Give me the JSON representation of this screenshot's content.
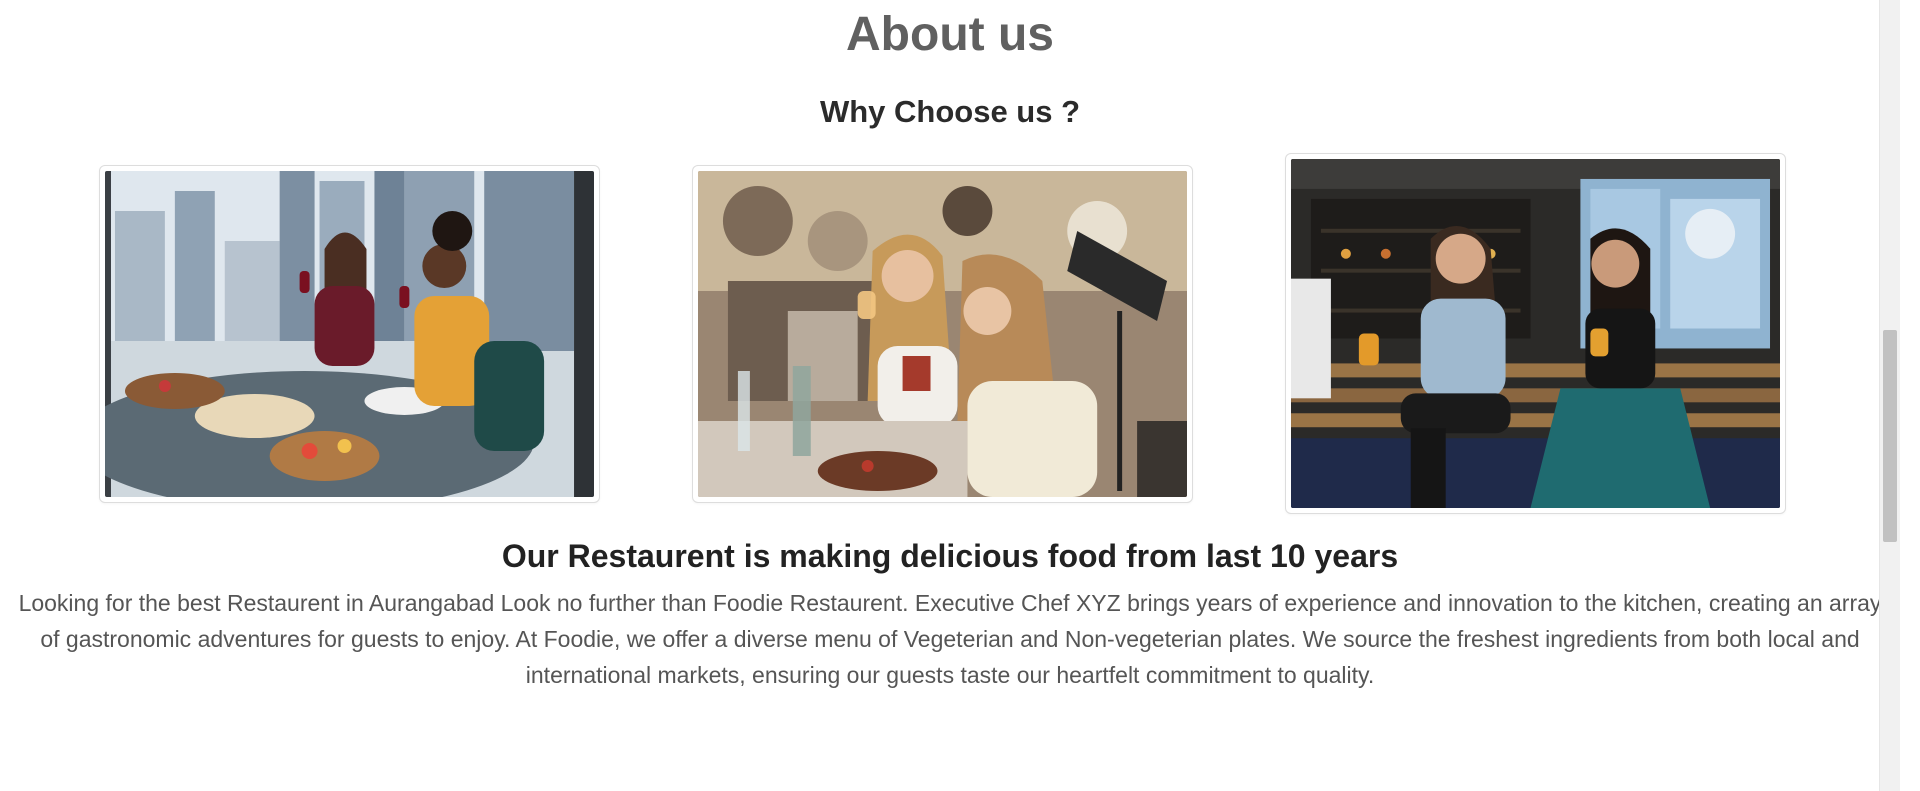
{
  "about": {
    "title": "About us",
    "subtitle": "Why Choose us ?"
  },
  "gallery": {
    "images": [
      {
        "name": "friends-dining-highrise-photo"
      },
      {
        "name": "women-drinking-at-restaurant-photo"
      },
      {
        "name": "friends-laughing-at-bar-photo"
      }
    ]
  },
  "story": {
    "headline": "Our Restaurent is making delicious food from last 10 years",
    "description": "Looking for the best Restaurent in Aurangabad Look no further than Foodie Restaurent. Executive Chef XYZ brings years of experience and innovation to the kitchen, creating an array of gastronomic adventures for guests to enjoy. At Foodie, we offer a diverse menu of Vegeterian and Non-vegeterian plates. We source the freshest ingredients from both local and international markets, ensuring our guests taste our heartfelt commitment to quality."
  },
  "colors": {
    "title": "#606060",
    "heading": "#222222",
    "body_text": "#555555",
    "card_border": "#dddddd"
  }
}
